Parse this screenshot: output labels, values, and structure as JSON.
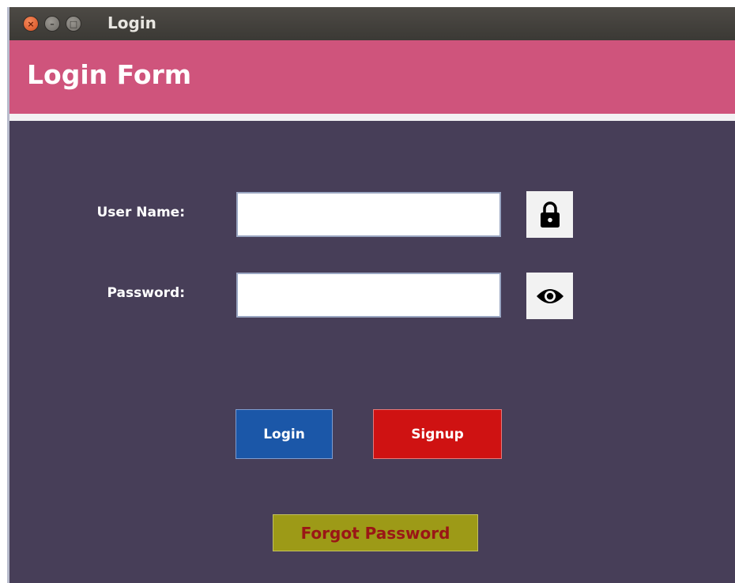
{
  "window": {
    "title": "Login",
    "controls": {
      "close": "×",
      "minimize": "–",
      "maximize": "□"
    }
  },
  "header": {
    "title": "Login Form"
  },
  "form": {
    "username_label": "User Name:",
    "username_value": "",
    "password_label": "Password:",
    "password_value": "",
    "lock_icon": "lock-icon",
    "eye_icon": "eye-icon"
  },
  "buttons": {
    "login": "Login",
    "signup": "Signup",
    "forgot": "Forgot Password"
  },
  "colors": {
    "banner": "#cf547c",
    "panel": "#473e58",
    "login_button": "#1b57a8",
    "signup_button": "#cf1212",
    "forgot_button": "#9d9a17",
    "forgot_text": "#9a1616"
  }
}
